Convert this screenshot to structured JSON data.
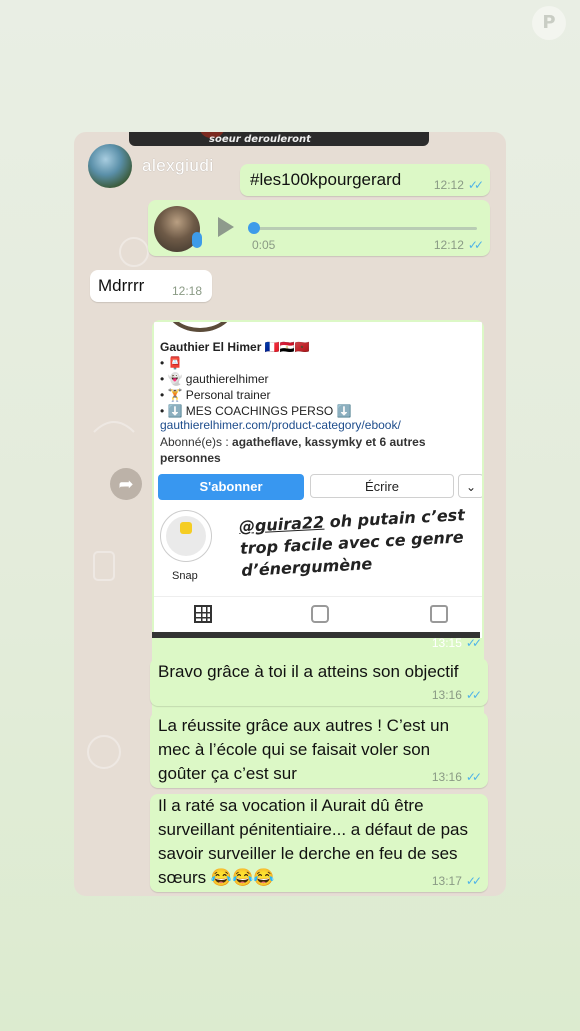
{
  "chat": {
    "sender": "alexgiudi",
    "top_caption": "soeur derouleront",
    "messages": [
      {
        "text": "#les100kpourgerard",
        "time": "12:12"
      },
      {
        "duration": "0:05",
        "time": "12:12"
      },
      {
        "text": "Mdrrrr",
        "time": "12:18"
      },
      {
        "text": "Bravo grâce à toi il a atteins son objectif",
        "time": "13:16"
      },
      {
        "text": "La réussite grâce aux autres ! C’est un mec à l’école qui se faisait voler son goûter ça c’est sur",
        "time": "13:16"
      },
      {
        "text": "Il a raté sa vocation il Aurait dû être surveillant pénitentiaire... a défaut de pas savoir surveiller le derche en feu de ses sœurs 😂😂😂",
        "time": "13:17"
      }
    ]
  },
  "instagram": {
    "name": "Gauthier El Himer 🇫🇷🇪🇬🇲🇦",
    "bio": [
      "• 📮",
      "• 👻 gauthierelhimer",
      "• 🏋️ Personal trainer",
      "• ⬇️ MES COACHINGS PERSO ⬇️"
    ],
    "link": "gauthierelhimer.com/product-category/ebook/",
    "followed_by_prefix": "Abonné(e)s : ",
    "followed_by": "agatheflave, kassymky et 6 autres personnes",
    "follow_button": "S'abonner",
    "message_button": "Écrire",
    "dropdown_icon": "⌄",
    "highlight_label": "Snap",
    "caption_handle": "@guira22",
    "caption_text": " oh putain c’est trop facile avec ce genre d’énergumène",
    "time": "13:15"
  },
  "ticks": "✓✓",
  "watermark": "P"
}
